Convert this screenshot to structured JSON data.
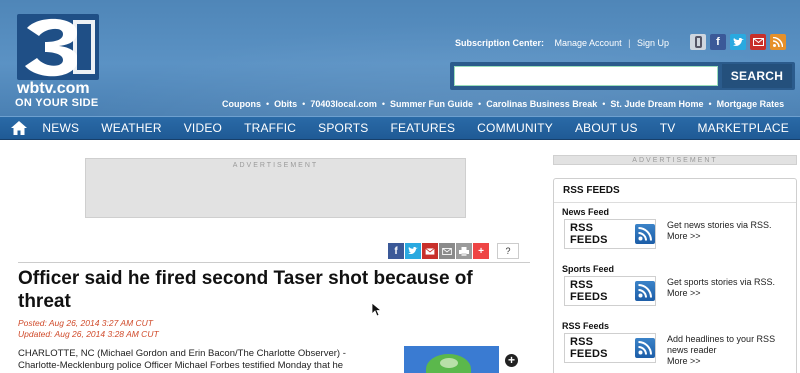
{
  "logo": {
    "mark": "3",
    "site": "wbtv.com",
    "tagline": "ON YOUR SIDE"
  },
  "subscription": {
    "label": "Subscription Center:",
    "manage": "Manage Account",
    "signup": "Sign Up"
  },
  "social_icons": [
    "mobile-icon",
    "facebook-icon",
    "twitter-icon",
    "mail-icon",
    "rss-icon"
  ],
  "search": {
    "value": "",
    "placeholder": "",
    "button": "SEARCH"
  },
  "quicklinks": [
    "Coupons",
    "Obits",
    "70403local.com",
    "Summer Fun Guide",
    "Carolinas Business Break",
    "St. Jude Dream Home",
    "Mortgage Rates"
  ],
  "nav": [
    "NEWS",
    "WEATHER",
    "VIDEO",
    "TRAFFIC",
    "SPORTS",
    "FEATURES",
    "COMMUNITY",
    "ABOUT US",
    "TV",
    "MARKETPLACE"
  ],
  "ad_label": "ADVERTISEMENT",
  "share": {
    "help": "?"
  },
  "article": {
    "headline": "Officer said he fired second Taser shot because of threat",
    "posted": "Posted: Aug 26, 2014 3:27 AM CUT",
    "updated": "Updated: Aug 26, 2014 3:28 AM CUT",
    "body_line1": "CHARLOTTE, NC (Michael Gordon and Erin Bacon/The Charlotte Observer) -",
    "body_line2": "Charlotte-Mecklenburg police Officer Michael Forbes testified Monday that he"
  },
  "rss": {
    "title": "RSS FEEDS",
    "button_text": "RSS FEEDS",
    "feeds": [
      {
        "name": "News Feed",
        "desc1": "Get news stories via RSS.",
        "desc2": "More >>"
      },
      {
        "name": "Sports Feed",
        "desc1": "Get sports stories via RSS.",
        "desc2": "More >>"
      },
      {
        "name": "RSS Feeds",
        "desc1": "Add headlines to your RSS news reader",
        "desc2": "More >>"
      }
    ]
  },
  "colors": {
    "header": "#5b92c4",
    "nav": "#1f5a95",
    "accent_red": "#d04a2a"
  }
}
